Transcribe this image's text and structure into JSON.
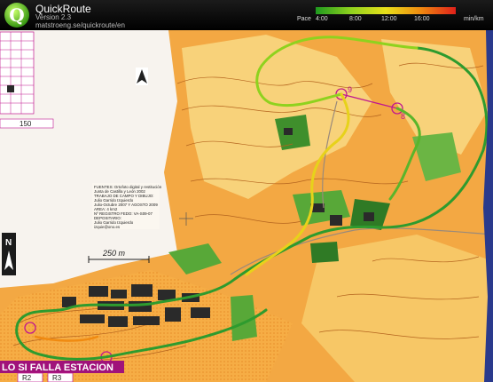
{
  "app": {
    "title": "QuickRoute",
    "version": "Version 2.3",
    "url": "matstroeng.se/quickroute/en",
    "logo_letter": "Q"
  },
  "pace_legend": {
    "label": "Pace",
    "ticks": [
      "4:00",
      "8:00",
      "12:00",
      "16:00"
    ],
    "unit": "min/km",
    "colors": [
      "#1f9a1f",
      "#8fd21e",
      "#e8e01a",
      "#f08a10",
      "#e0201a"
    ]
  },
  "map": {
    "scale_label": "250 m",
    "info_block": [
      "FUENTES: Ortofoto digital y restitución",
      "Junta de Castilla y León 2002",
      "TRABAJO DE CAMPO Y DIBUJO:",
      "Julio Garrido Izquierdo",
      "Julio-Octubre 2007 Y AGOSTO 2009",
      "AREA: 4 km2",
      "Nº REGISTRO FEDO: VA-S09-07",
      "DEPOSITARIO:",
      "Julio Garrido Izquierdo",
      "izquie@ono.es"
    ],
    "bottom_banner": "LO SI FALLA ESTACION",
    "start_boxes": [
      "R2",
      "R3"
    ],
    "legend_box_value": "150",
    "north_symbol": "N",
    "colors": {
      "paper": "#f4e8d4",
      "open_land": "#f2a23a",
      "rough_open": "#f8d37a",
      "forest_green": "#58a838",
      "dark_green": "#2f7a25",
      "contour": "#b4641e",
      "building": "#2a2a2a",
      "course": "#c0178f",
      "route_slow": "#e7d21a",
      "route_fast": "#2e9b2e"
    }
  }
}
